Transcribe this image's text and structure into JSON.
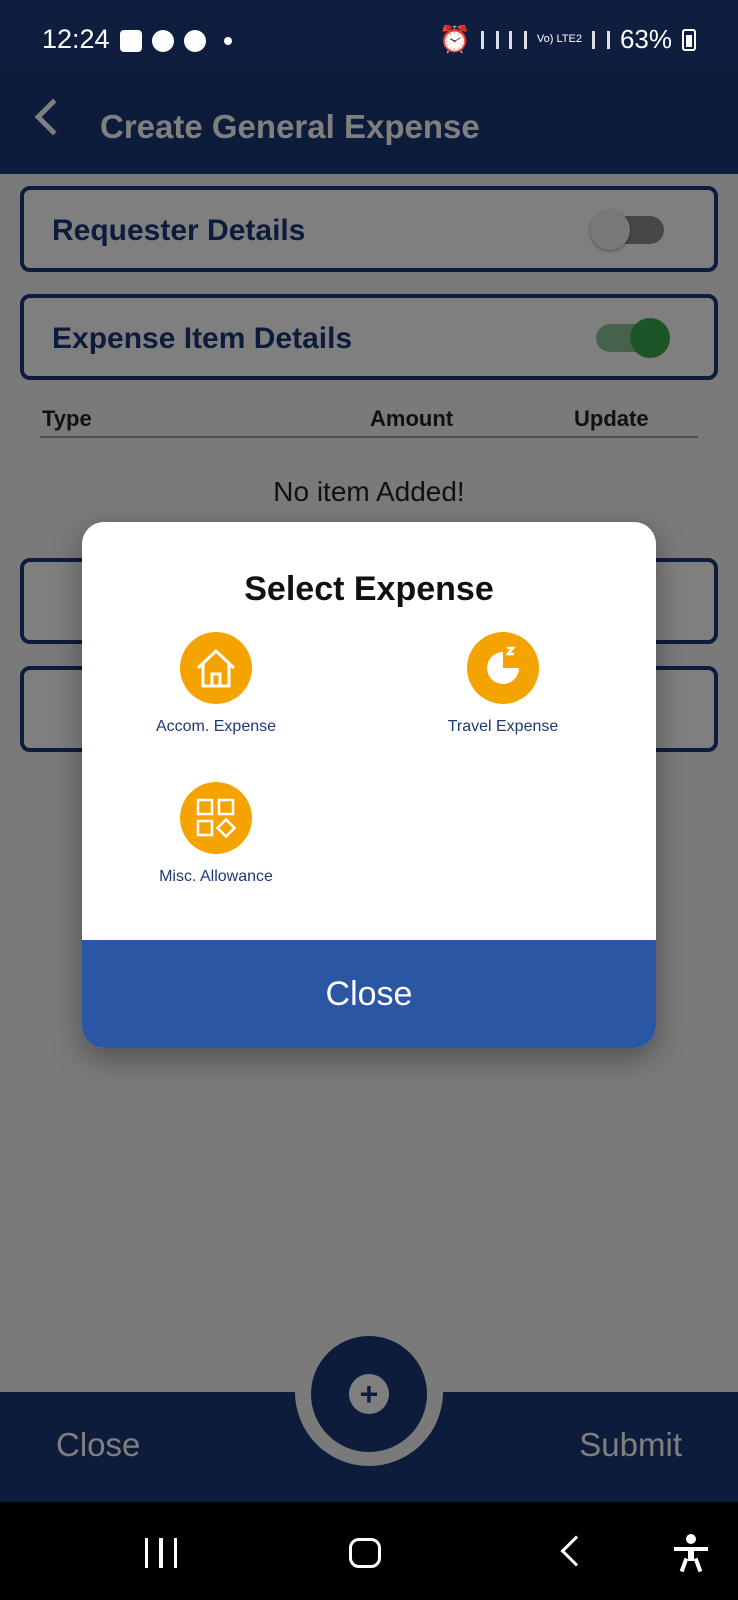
{
  "status_bar": {
    "time": "12:24",
    "battery": "63%",
    "network_label": "Vo) LTE2"
  },
  "header": {
    "title": "Create General Expense"
  },
  "sections": [
    {
      "label": "Requester Details",
      "toggle_on": false
    },
    {
      "label": "Expense Item Details",
      "toggle_on": true
    }
  ],
  "table": {
    "columns": [
      "Type",
      "Amount",
      "Update"
    ],
    "empty_text": "No item Added!"
  },
  "modal": {
    "title": "Select Expense",
    "options": [
      {
        "label": "Accom. Expense",
        "icon": "house-icon"
      },
      {
        "label": "Travel Expense",
        "icon": "pie-chart-icon"
      },
      {
        "label": "Misc. Allowance",
        "icon": "apps-grid-icon"
      }
    ],
    "close_label": "Close"
  },
  "bottom_bar": {
    "close_label": "Close",
    "submit_label": "Submit",
    "add_icon": "plus-icon"
  },
  "colors": {
    "primary": "#1d3979",
    "accent": "#f5a300",
    "toggle_on": "#3aa84a",
    "modal_button": "#2b56a4"
  }
}
